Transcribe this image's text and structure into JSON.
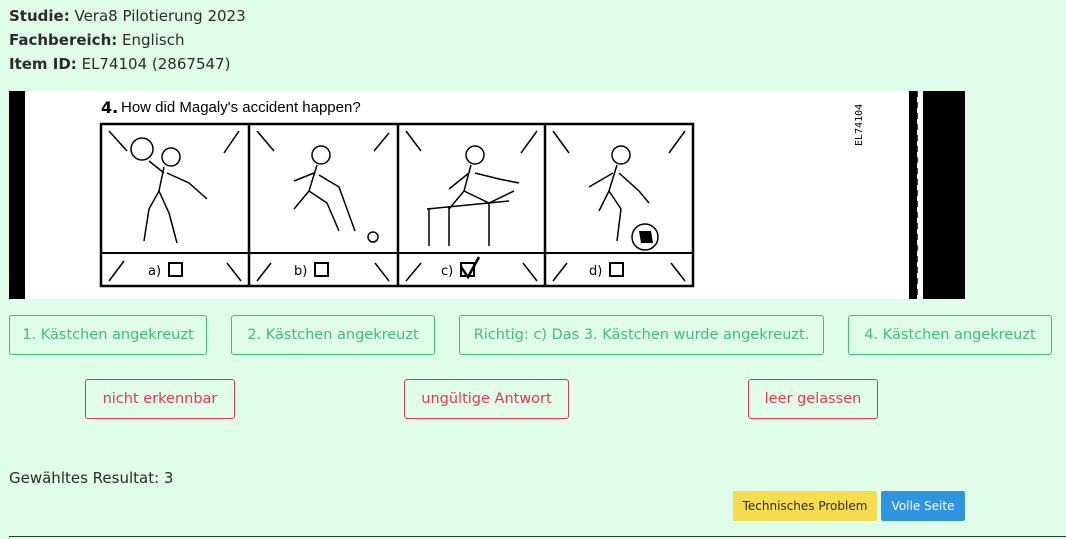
{
  "meta": {
    "study_label": "Studie:",
    "study_value": "Vera8 Pilotierung 2023",
    "area_label": "Fachbereich:",
    "area_value": "Englisch",
    "item_label": "Item ID:",
    "item_value": "EL74104 (2867547)"
  },
  "scan": {
    "question_number": "4.",
    "question_text": "How did Magaly's accident happen?",
    "side_code": "EL74104",
    "options": [
      "a)",
      "b)",
      "c)",
      "d)"
    ],
    "checked_option": "c)"
  },
  "answers": {
    "opt1": "1. Kästchen angekreuzt",
    "opt2": "2. Kästchen angekreuzt",
    "opt3": "Richtig: c) Das 3. Kästchen wurde angekreuzt.",
    "opt4": "4. Kästchen angekreuzt",
    "not_readable": "nicht erkennbar",
    "invalid": "ungültige Antwort",
    "empty": "leer gelassen"
  },
  "result": {
    "text": "Gewähltes Resultat: 3"
  },
  "footer": {
    "tech_problem": "Technisches Problem",
    "full_page": "Volle Seite"
  },
  "colors": {
    "background": "#e0fde9",
    "green": "#3fbf74",
    "red": "#e2394e",
    "yellow": "#f6dc4f",
    "blue": "#2f95dc"
  }
}
